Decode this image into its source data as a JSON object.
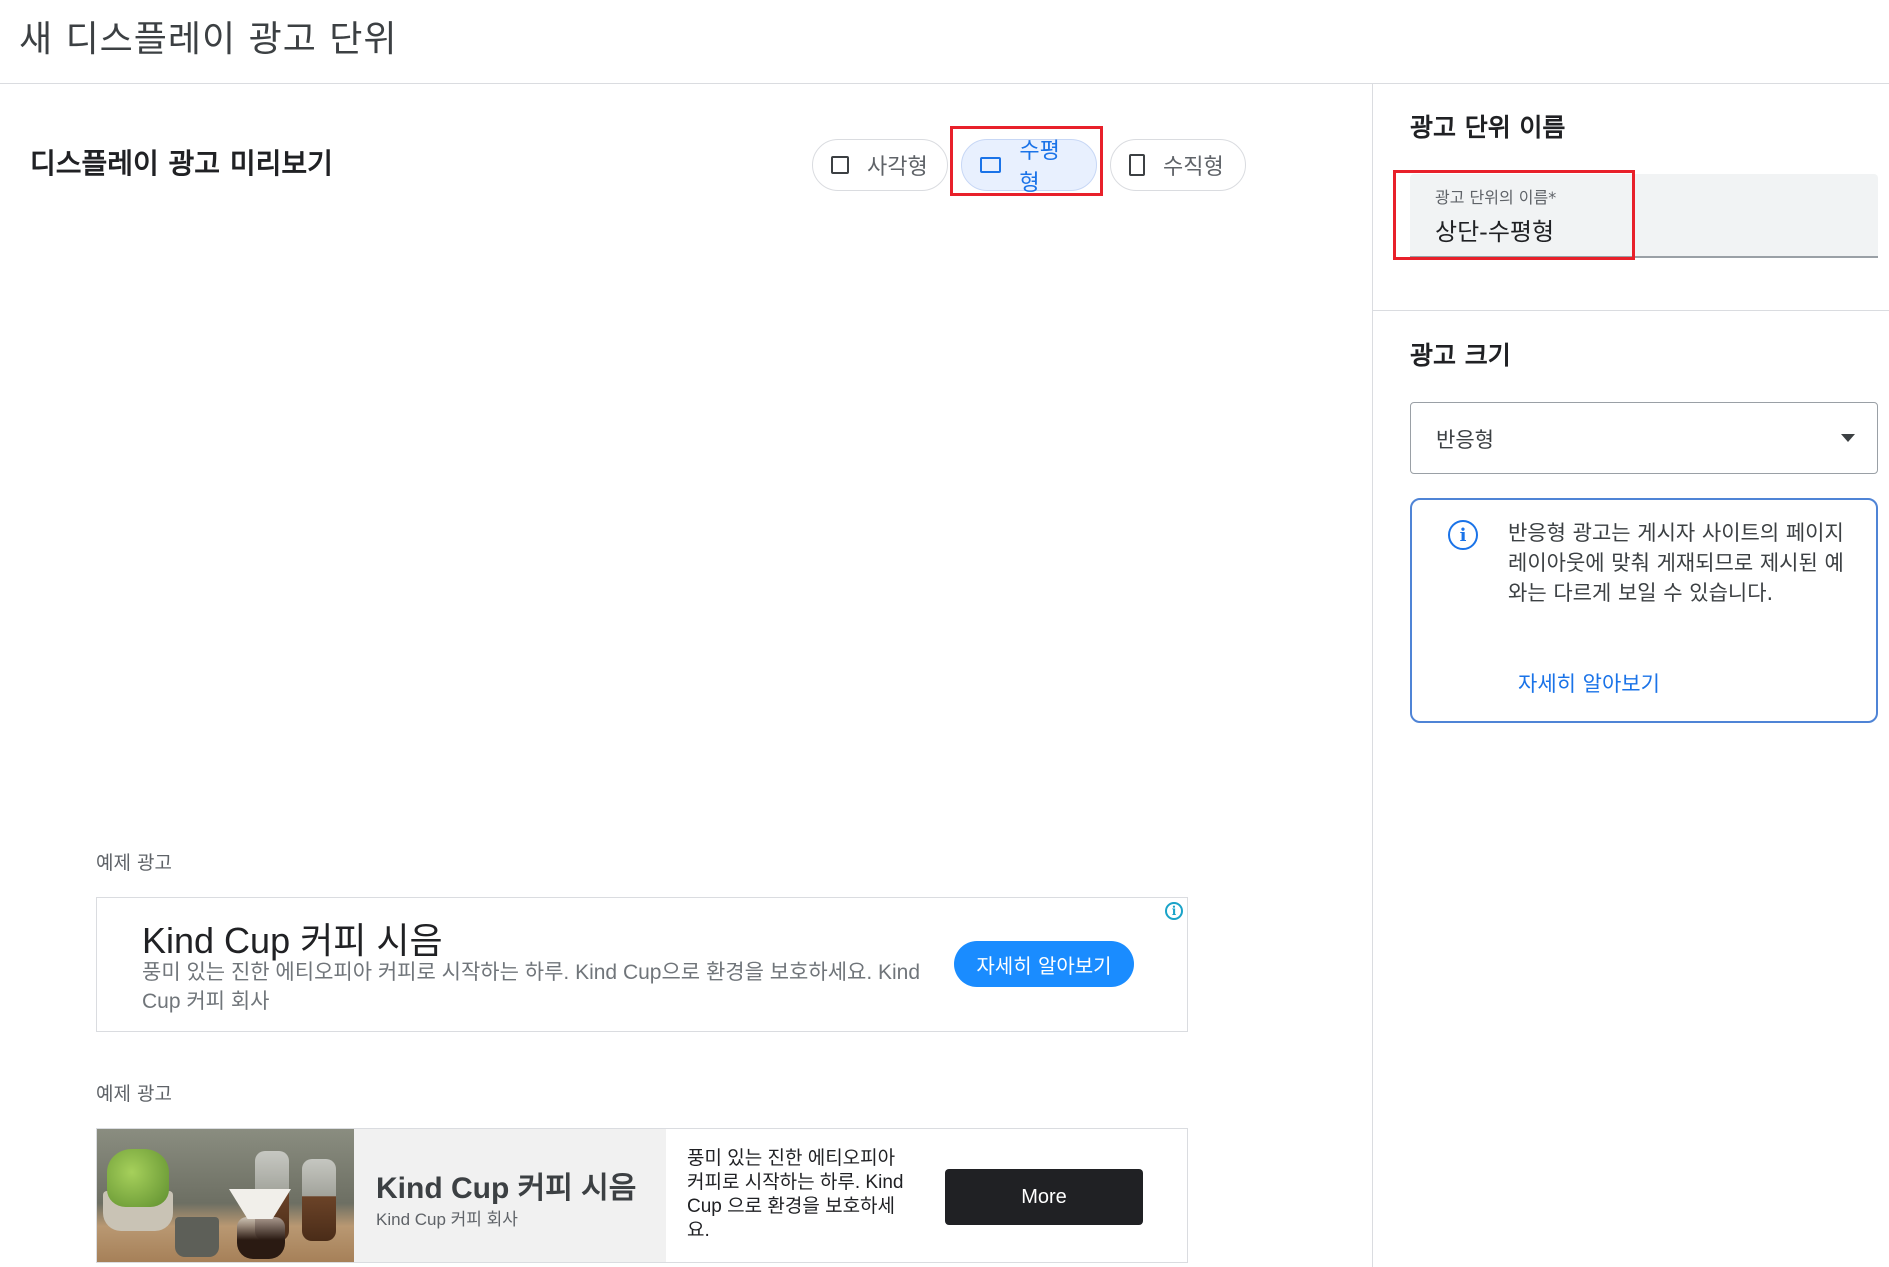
{
  "page": {
    "title": "새 디스플레이 광고 단위"
  },
  "preview": {
    "title": "디스플레이 광고 미리보기",
    "shapes": [
      {
        "label": "사각형",
        "icon": "square-icon",
        "selected": false
      },
      {
        "label": "수평형",
        "icon": "horizontal-rect-icon",
        "selected": true
      },
      {
        "label": "수직형",
        "icon": "vertical-rect-icon",
        "selected": false
      }
    ],
    "samples": [
      {
        "label": "예제 광고",
        "title": "Kind Cup 커피 시음",
        "description": "풍미 있는 진한 에티오피아 커피로 시작하는 하루. Kind Cup으로 환경을 보호하세요. Kind Cup 커피 회사",
        "cta": "자세히 알아보기",
        "adchoices_icon": "info-icon"
      },
      {
        "label": "예제 광고",
        "title": "Kind Cup 커피 시음",
        "brand": "Kind Cup 커피 회사",
        "description": "풍미 있는 진한 에티오피아 커피로 시작하는 하루. Kind Cup 으로 환경을 보호하세요.",
        "cta": "More",
        "image": "coffee-product-photo"
      }
    ]
  },
  "sidebar": {
    "name_section_title": "광고 단위 이름",
    "name_field": {
      "label": "광고 단위의 이름*",
      "value": "상단-수평형"
    },
    "size_section_title": "광고 크기",
    "size_select": {
      "value": "반응형"
    },
    "info": {
      "text": "반응형 광고는 게시자 사이트의 페이지 레이아웃에 맞춰 게재되므로 제시된 예와는 다르게 보일 수 있습니다.",
      "link": "자세히 알아보기"
    }
  },
  "colors": {
    "accent": "#1a73e8",
    "highlight": "#e8202a",
    "ad_cta": "#1a8cff"
  }
}
